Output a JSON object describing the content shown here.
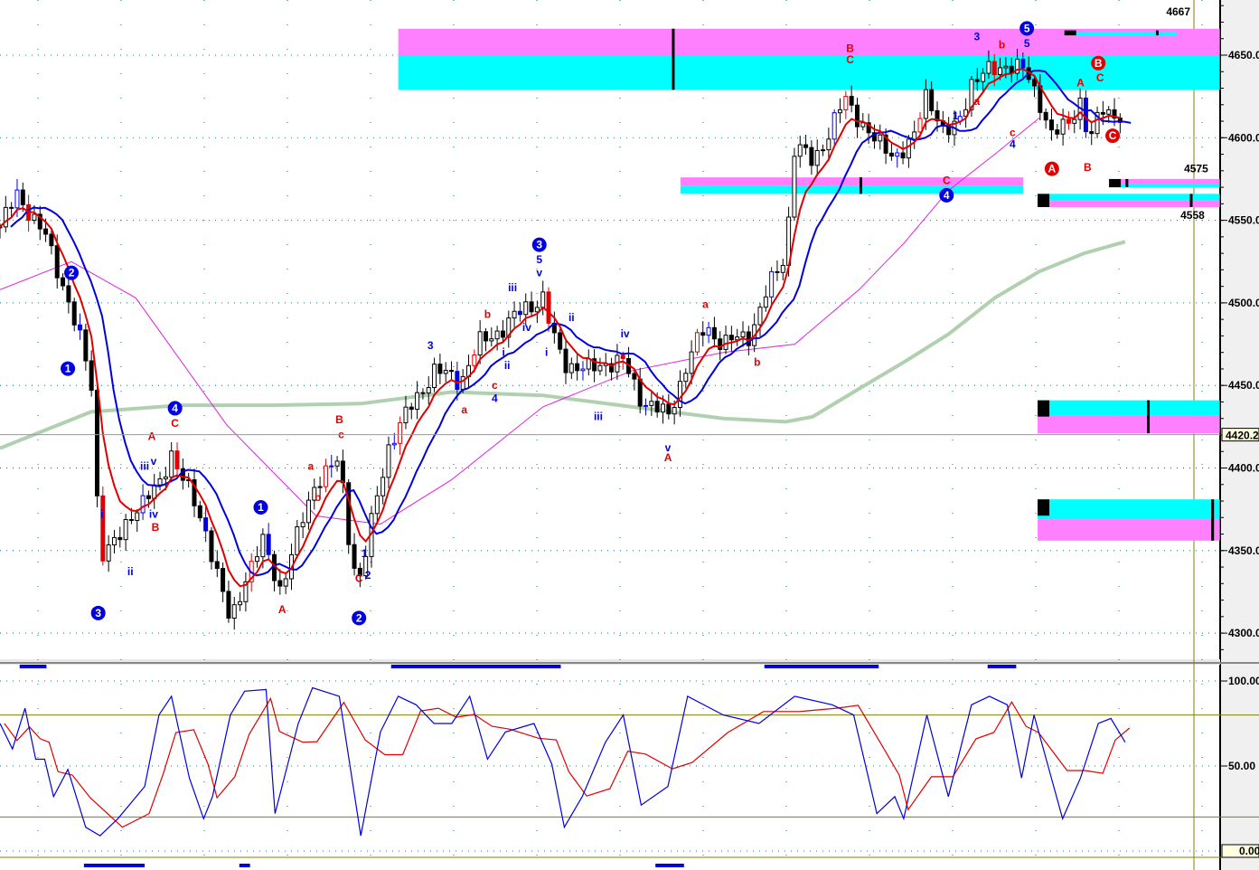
{
  "chart_data": {
    "type": "candlestick",
    "title": "",
    "price_axis": {
      "ticks": [
        "4650.00",
        "4600.00",
        "4550.00",
        "4500.00",
        "4450.00",
        "4400.00",
        "4350.00",
        "4300.00"
      ],
      "tick_values": [
        4650,
        4600,
        4550,
        4500,
        4450,
        4400,
        4350,
        4300
      ],
      "ylim": [
        4285,
        4684
      ]
    },
    "last_price": {
      "label": "4420.2",
      "value": 4420.2
    },
    "close_points": [
      [
        0,
        4546
      ],
      [
        1,
        4566
      ],
      [
        2.5,
        4541
      ],
      [
        3.8,
        4503
      ],
      [
        5.1,
        4453
      ],
      [
        5.6,
        4349
      ],
      [
        6.6,
        4355
      ],
      [
        7.6,
        4377
      ],
      [
        8.9,
        4388
      ],
      [
        9.6,
        4410
      ],
      [
        10.6,
        4385
      ],
      [
        11.6,
        4360
      ],
      [
        12.9,
        4305
      ],
      [
        13.7,
        4333
      ],
      [
        14.7,
        4355
      ],
      [
        15.7,
        4327
      ],
      [
        16.7,
        4360
      ],
      [
        17.7,
        4393
      ],
      [
        19.0,
        4404
      ],
      [
        19.7,
        4344
      ],
      [
        20.2,
        4333
      ],
      [
        21.0,
        4377
      ],
      [
        21.8,
        4415
      ],
      [
        23.3,
        4442
      ],
      [
        24.3,
        4459
      ],
      [
        25.8,
        4453
      ],
      [
        26.8,
        4475
      ],
      [
        28.3,
        4486
      ],
      [
        29.4,
        4497
      ],
      [
        30.4,
        4503
      ],
      [
        30.9,
        4481
      ],
      [
        31.6,
        4464
      ],
      [
        32.9,
        4459
      ],
      [
        33.9,
        4464
      ],
      [
        34.9,
        4464
      ],
      [
        35.9,
        4442
      ],
      [
        37.4,
        4431
      ],
      [
        38.5,
        4464
      ],
      [
        39.5,
        4486
      ],
      [
        40.5,
        4475
      ],
      [
        42.0,
        4481
      ],
      [
        43.0,
        4508
      ],
      [
        44.0,
        4530
      ],
      [
        44.5,
        4596
      ],
      [
        45.5,
        4585
      ],
      [
        46.3,
        4601
      ],
      [
        47.3,
        4623
      ],
      [
        48.1,
        4612
      ],
      [
        49.1,
        4596
      ],
      [
        50.1,
        4590
      ],
      [
        51.1,
        4596
      ],
      [
        51.9,
        4629
      ],
      [
        52.9,
        4601
      ],
      [
        53.6,
        4607
      ],
      [
        54.4,
        4634
      ],
      [
        55.4,
        4640
      ],
      [
        56.4,
        4645
      ],
      [
        57.4,
        4640
      ],
      [
        58.2,
        4623
      ],
      [
        58.9,
        4601
      ],
      [
        59.7,
        4607
      ],
      [
        60.5,
        4623
      ],
      [
        61.0,
        4596
      ],
      [
        61.7,
        4618
      ],
      [
        63.0,
        4612
      ]
    ],
    "ma_slow": [
      [
        0,
        4412
      ],
      [
        5.1,
        4434
      ],
      [
        10.1,
        4438
      ],
      [
        15.2,
        4438
      ],
      [
        20.2,
        4439
      ],
      [
        25.3,
        4446
      ],
      [
        30.4,
        4444
      ],
      [
        35.4,
        4437
      ],
      [
        40.5,
        4430
      ],
      [
        44.0,
        4428
      ],
      [
        45.5,
        4431
      ],
      [
        48.1,
        4448
      ],
      [
        50.6,
        4464
      ],
      [
        53.1,
        4481
      ],
      [
        55.7,
        4503
      ],
      [
        58.2,
        4519
      ],
      [
        60.7,
        4530
      ],
      [
        63.0,
        4537
      ]
    ],
    "ma_mid": [
      [
        0,
        4508
      ],
      [
        4.0,
        4525
      ],
      [
        7.6,
        4503
      ],
      [
        12.7,
        4426
      ],
      [
        17.7,
        4371
      ],
      [
        21.3,
        4366
      ],
      [
        25.3,
        4393
      ],
      [
        30.4,
        4437
      ],
      [
        35.4,
        4459
      ],
      [
        40.5,
        4470
      ],
      [
        44.5,
        4475
      ],
      [
        48.1,
        4508
      ],
      [
        50.6,
        4536
      ],
      [
        53.1,
        4568
      ],
      [
        55.7,
        4590
      ],
      [
        58.2,
        4612
      ]
    ],
    "zones": [
      {
        "from": 22.3,
        "to": 68.3,
        "magenta": [
          4650,
          4666
        ],
        "cyan": [
          4629,
          4650
        ],
        "marker": 37.7
      },
      {
        "from": 38.1,
        "to": 57.3,
        "magenta": [
          4571,
          4576
        ],
        "cyan": [
          4566,
          4571
        ],
        "marker": 48.2
      },
      {
        "from": 59.6,
        "to": 65.9,
        "magenta": [
          4663,
          4665
        ],
        "cyan": [
          4662,
          4664
        ],
        "marker": 64.8
      },
      {
        "from": 62.1,
        "to": 68.3,
        "magenta": [
          4572,
          4575
        ],
        "cyan": [
          4570,
          4572
        ],
        "marker": 63.1
      },
      {
        "from": 58.1,
        "to": 68.3,
        "magenta": [
          4558,
          4562
        ],
        "cyan": [
          4562,
          4566
        ],
        "marker": 66.7
      },
      {
        "from": 58.1,
        "to": 68.3,
        "magenta": [
          4421,
          4432
        ],
        "cyan": [
          4432,
          4441
        ],
        "marker": 64.3
      },
      {
        "from": 58.1,
        "to": 68.3,
        "magenta": [
          4356,
          4369
        ],
        "cyan": [
          4369,
          4381
        ],
        "marker": 67.9
      }
    ],
    "level_labels": [
      {
        "text": "4667",
        "bar": 65.3,
        "price": 4674
      },
      {
        "text": "4575",
        "bar": 66.3,
        "price": 4579
      },
      {
        "text": "4558",
        "bar": 66.1,
        "price": 4551
      }
    ],
    "wave_labels": [
      {
        "t": "2",
        "b": 4.0,
        "p": 4516,
        "c": "#0000e0",
        "circle": true
      },
      {
        "t": "1",
        "b": 3.8,
        "p": 4458,
        "c": "#0000e0",
        "circle": true
      },
      {
        "t": "3",
        "b": 5.5,
        "p": 4310,
        "c": "#0000e0",
        "circle": true
      },
      {
        "t": "4",
        "b": 9.8,
        "p": 4434,
        "c": "#0000e0",
        "circle": true
      },
      {
        "t": "C",
        "b": 9.8,
        "p": 4425,
        "c": "#e00000"
      },
      {
        "t": "A",
        "b": 8.5,
        "p": 4417,
        "c": "#e00000"
      },
      {
        "t": "iii",
        "b": 8.1,
        "p": 4399,
        "c": "#0000e0"
      },
      {
        "t": "v",
        "b": 8.6,
        "p": 4402,
        "c": "#0000e0"
      },
      {
        "t": "iv",
        "b": 8.6,
        "p": 4370,
        "c": "#0000e0"
      },
      {
        "t": "B",
        "b": 8.7,
        "p": 4362,
        "c": "#e00000"
      },
      {
        "t": "i",
        "b": 5.7,
        "p": 4370,
        "c": "#0000e0"
      },
      {
        "t": "ii",
        "b": 7.3,
        "p": 4335,
        "c": "#0000e0"
      },
      {
        "t": "1",
        "b": 14.6,
        "p": 4374,
        "c": "#0000e0",
        "circle": true
      },
      {
        "t": "A",
        "b": 15.8,
        "p": 4312,
        "c": "#e00000"
      },
      {
        "t": "a",
        "b": 17.4,
        "p": 4399,
        "c": "#e00000"
      },
      {
        "t": "b",
        "b": 17.8,
        "p": 4380,
        "c": "#e00000"
      },
      {
        "t": "B",
        "b": 19.0,
        "p": 4427,
        "c": "#e00000"
      },
      {
        "t": "c",
        "b": 19.1,
        "p": 4418,
        "c": "#e00000"
      },
      {
        "t": "1",
        "b": 20.4,
        "p": 4346,
        "c": "#0000e0"
      },
      {
        "t": "2",
        "b": 20.6,
        "p": 4333,
        "c": "#0000e0"
      },
      {
        "t": "C",
        "b": 20.1,
        "p": 4331,
        "c": "#e00000"
      },
      {
        "t": "2",
        "b": 20.1,
        "p": 4307,
        "c": "#0000e0",
        "circle": true
      },
      {
        "t": "3",
        "b": 24.1,
        "p": 4472,
        "c": "#0000e0"
      },
      {
        "t": "3",
        "b": 30.2,
        "p": 4533,
        "c": "#0000e0",
        "circle": true
      },
      {
        "t": "5",
        "b": 30.2,
        "p": 4524,
        "c": "#0000e0"
      },
      {
        "t": "v",
        "b": 30.2,
        "p": 4516,
        "c": "#0000e0"
      },
      {
        "t": "iii",
        "b": 28.7,
        "p": 4507,
        "c": "#0000e0"
      },
      {
        "t": "b",
        "b": 27.3,
        "p": 4491,
        "c": "#e00000"
      },
      {
        "t": "iv",
        "b": 29.5,
        "p": 4483,
        "c": "#0000e0"
      },
      {
        "t": "i",
        "b": 28.2,
        "p": 4468,
        "c": "#0000e0"
      },
      {
        "t": "ii",
        "b": 28.4,
        "p": 4460,
        "c": "#0000e0"
      },
      {
        "t": "a",
        "b": 26.0,
        "p": 4433,
        "c": "#e00000"
      },
      {
        "t": "c",
        "b": 27.7,
        "p": 4448,
        "c": "#e00000"
      },
      {
        "t": "4",
        "b": 27.7,
        "p": 4440,
        "c": "#0000e0"
      },
      {
        "t": "i",
        "b": 30.6,
        "p": 4468,
        "c": "#0000e0"
      },
      {
        "t": "ii",
        "b": 32.0,
        "p": 4489,
        "c": "#0000e0"
      },
      {
        "t": "iv",
        "b": 35.0,
        "p": 4479,
        "c": "#0000e0"
      },
      {
        "t": "iii",
        "b": 33.5,
        "p": 4429,
        "c": "#0000e0"
      },
      {
        "t": "v",
        "b": 37.4,
        "p": 4410,
        "c": "#0000e0"
      },
      {
        "t": "A",
        "b": 37.4,
        "p": 4404,
        "c": "#e00000"
      },
      {
        "t": "a",
        "b": 39.5,
        "p": 4497,
        "c": "#e00000"
      },
      {
        "t": "b",
        "b": 42.4,
        "p": 4462,
        "c": "#e00000"
      },
      {
        "t": "B",
        "b": 47.6,
        "p": 4652,
        "c": "#e00000"
      },
      {
        "t": "C",
        "b": 47.6,
        "p": 4645,
        "c": "#e00000"
      },
      {
        "t": "3",
        "b": 54.7,
        "p": 4659,
        "c": "#0000e0"
      },
      {
        "t": "b",
        "b": 56.1,
        "p": 4654,
        "c": "#e00000"
      },
      {
        "t": "5",
        "b": 57.5,
        "p": 4664,
        "c": "#0000e0",
        "circle": true
      },
      {
        "t": "5",
        "b": 57.5,
        "p": 4655,
        "c": "#0000e0"
      },
      {
        "t": "a",
        "b": 54.7,
        "p": 4620,
        "c": "#e00000"
      },
      {
        "t": "1",
        "b": 53.5,
        "p": 4611,
        "c": "#0000e0"
      },
      {
        "t": "c",
        "b": 56.7,
        "p": 4601,
        "c": "#e00000"
      },
      {
        "t": "4",
        "b": 56.7,
        "p": 4594,
        "c": "#0000e0"
      },
      {
        "t": "C",
        "b": 53.0,
        "p": 4572,
        "c": "#e00000"
      },
      {
        "t": "4",
        "b": 53.0,
        "p": 4563,
        "c": "#0000e0",
        "circle": true
      },
      {
        "t": "A",
        "b": 58.9,
        "p": 4579,
        "c": "#e00000",
        "circle": true
      },
      {
        "t": "B",
        "b": 61.5,
        "p": 4643,
        "c": "#e00000",
        "circle": true
      },
      {
        "t": "C",
        "b": 61.6,
        "p": 4634,
        "c": "#e00000"
      },
      {
        "t": "A",
        "b": 60.5,
        "p": 4631,
        "c": "#e00000"
      },
      {
        "t": "B",
        "b": 60.9,
        "p": 4580,
        "c": "#e00000"
      },
      {
        "t": "C",
        "b": 62.3,
        "p": 4599,
        "c": "#e00000",
        "circle": true
      }
    ],
    "oscillator": {
      "type": "line",
      "ticks": [
        "100.00",
        "50.00",
        "0.00"
      ],
      "tick_values": [
        100,
        50,
        0
      ],
      "levels": [
        80,
        20
      ],
      "ylim": [
        0,
        100
      ],
      "k": [
        [
          0,
          75
        ],
        [
          0.7,
          60
        ],
        [
          1.4,
          84
        ],
        [
          2.0,
          54
        ],
        [
          2.5,
          54
        ],
        [
          3.0,
          32
        ],
        [
          3.8,
          48
        ],
        [
          4.8,
          14
        ],
        [
          5.6,
          9
        ],
        [
          6.6,
          19
        ],
        [
          8.1,
          38
        ],
        [
          8.9,
          80
        ],
        [
          9.6,
          91
        ],
        [
          10.6,
          43
        ],
        [
          11.4,
          19
        ],
        [
          11.9,
          32
        ],
        [
          12.9,
          80
        ],
        [
          13.7,
          94
        ],
        [
          14.9,
          95
        ],
        [
          15.4,
          22
        ],
        [
          16.7,
          75
        ],
        [
          17.5,
          96
        ],
        [
          19.0,
          91
        ],
        [
          20.2,
          9
        ],
        [
          21.3,
          70
        ],
        [
          22.3,
          91
        ],
        [
          23.3,
          86
        ],
        [
          24.3,
          75
        ],
        [
          25.3,
          75
        ],
        [
          26.3,
          91
        ],
        [
          27.3,
          54
        ],
        [
          28.3,
          70
        ],
        [
          29.9,
          75
        ],
        [
          30.9,
          51
        ],
        [
          31.6,
          14
        ],
        [
          32.6,
          32
        ],
        [
          33.9,
          64
        ],
        [
          34.9,
          80
        ],
        [
          35.9,
          27
        ],
        [
          37.4,
          38
        ],
        [
          38.5,
          91
        ],
        [
          40.5,
          80
        ],
        [
          42.5,
          75
        ],
        [
          44.5,
          91
        ],
        [
          46.6,
          86
        ],
        [
          47.8,
          80
        ],
        [
          49.1,
          22
        ],
        [
          50.1,
          32
        ],
        [
          50.6,
          19
        ],
        [
          51.9,
          80
        ],
        [
          53.1,
          32
        ],
        [
          54.4,
          86
        ],
        [
          55.4,
          91
        ],
        [
          56.4,
          86
        ],
        [
          57.2,
          43
        ],
        [
          57.9,
          80
        ],
        [
          59.5,
          19
        ],
        [
          60.5,
          43
        ],
        [
          61.5,
          75
        ],
        [
          62.2,
          78
        ],
        [
          63.0,
          64
        ]
      ]
    },
    "signal_bars_top": [
      [
        1.1,
        2.6
      ],
      [
        21.9,
        31.4
      ],
      [
        42.8,
        49.2
      ],
      [
        55.3,
        56.9
      ]
    ],
    "signal_bars_bottom": [
      [
        4.7,
        8.1
      ],
      [
        13.4,
        14.0
      ],
      [
        36.7,
        38.3
      ]
    ],
    "colors": {
      "magenta": "#ff80ff",
      "cyan": "#00ffff",
      "fast": "#e00000",
      "slow": "#0000e0",
      "ma_mid": "#e020e0",
      "ma_slow": "#b0d0b0",
      "grid": "#008080"
    }
  }
}
